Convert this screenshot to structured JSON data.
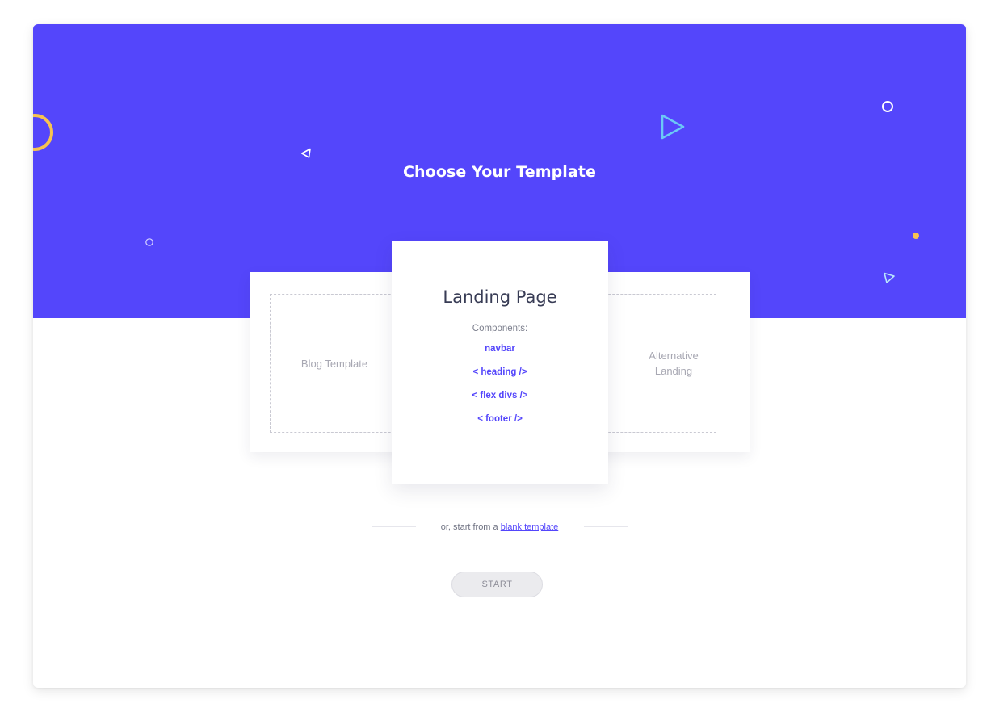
{
  "hero": {
    "title": "Choose Your Template"
  },
  "templates": {
    "left": {
      "label": "Blog Template"
    },
    "center": {
      "title": "Landing Page",
      "components_label": "Components:",
      "components": [
        "navbar",
        "< heading />",
        "< flex divs />",
        "< footer />"
      ]
    },
    "right": {
      "label": "Alternative Landing"
    }
  },
  "blank": {
    "prefix": "or, start from a",
    "link": "blank template"
  },
  "start_button": "START",
  "colors": {
    "primary": "#5446fb",
    "accent_yellow": "#f7c350",
    "accent_cyan": "#6cc9f6"
  },
  "decorations": [
    "half-circle-icon",
    "play-triangle-icon",
    "ring-icon",
    "triangle-left-icon",
    "dot-icon",
    "triangle-down-icon",
    "small-ring-icon"
  ]
}
